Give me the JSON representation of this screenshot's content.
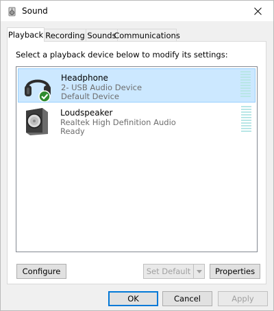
{
  "window": {
    "title": "Sound",
    "close_label": "✕"
  },
  "tabs": [
    {
      "label": "Playback",
      "active": true
    },
    {
      "label": "Recording",
      "active": false
    },
    {
      "label": "Sounds",
      "active": false
    },
    {
      "label": "Communications",
      "active": false
    }
  ],
  "playback": {
    "instruction": "Select a playback device below to modify its settings:",
    "devices": [
      {
        "name": "Headphone",
        "driver": "2- USB Audio Device",
        "status": "Default Device",
        "icon": "headphone-icon",
        "selected": true
      },
      {
        "name": "Loudspeaker",
        "driver": "Realtek High Definition Audio",
        "status": "Ready",
        "icon": "speaker-icon",
        "selected": false
      }
    ]
  },
  "buttons": {
    "configure": "Configure",
    "set_default": "Set Default",
    "properties": "Properties",
    "ok": "OK",
    "cancel": "Cancel",
    "apply": "Apply"
  },
  "colors": {
    "selection_bg": "#cce8ff",
    "selection_border": "#99d1ff",
    "meter": "#b8e6e6",
    "check_green": "#2e8b2e"
  }
}
